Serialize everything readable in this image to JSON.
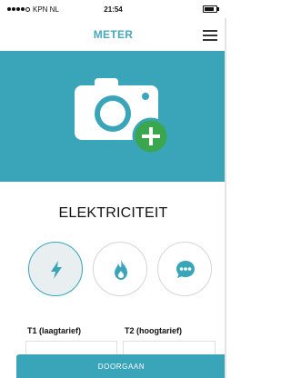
{
  "status_bar": {
    "carrier": "KPN NL",
    "time": "21:54"
  },
  "nav": {
    "title": "METER",
    "menu_icon": "hamburger-icon"
  },
  "banner": {
    "icon": "camera-add-icon",
    "background": "#3aa5b9",
    "badge_color": "#3aa74f"
  },
  "section": {
    "title": "ELEKTRICITEIT"
  },
  "meter_types": [
    {
      "icon": "lightning-icon",
      "selected": true
    },
    {
      "icon": "flame-icon",
      "selected": false
    },
    {
      "icon": "chat-icon",
      "selected": false
    }
  ],
  "tariffs": {
    "t1_label": "T1 (laagtarief)",
    "t2_label": "T2 (hoogtarief)"
  },
  "actions": {
    "continue_label": "DOORGAAN"
  },
  "colors": {
    "accent": "#3aa5b9",
    "title": "#49a9b9",
    "badge": "#3aa74f"
  }
}
